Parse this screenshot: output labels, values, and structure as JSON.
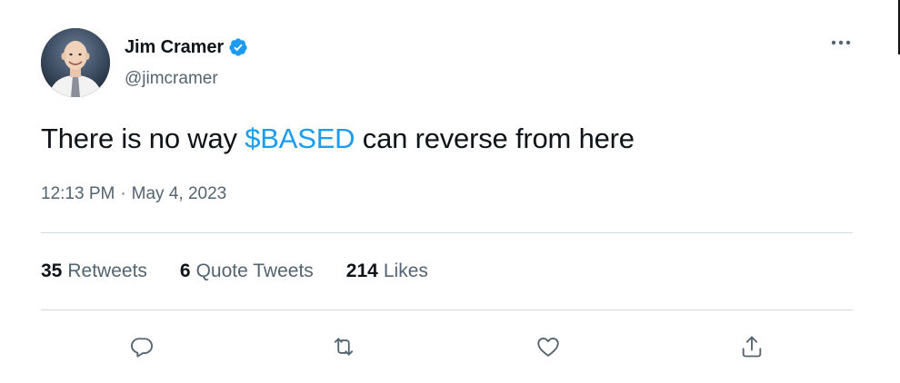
{
  "tweet": {
    "author": {
      "display_name": "Jim Cramer",
      "handle": "@jimcramer",
      "verified": true
    },
    "text_before": "There is no way ",
    "cashtag": "$BASED",
    "text_after": " can reverse from here",
    "time": "12:13 PM",
    "separator": "·",
    "date": "May 4, 2023"
  },
  "stats": [
    {
      "count": "35",
      "label": "Retweets"
    },
    {
      "count": "6",
      "label": "Quote Tweets"
    },
    {
      "count": "214",
      "label": "Likes"
    }
  ],
  "actions": [
    "reply",
    "retweet",
    "like",
    "share"
  ],
  "colors": {
    "accent": "#1d9bf0",
    "text": "#0f1419",
    "secondary": "#536471",
    "divider": "#cfd9de",
    "icon": "#536471"
  }
}
